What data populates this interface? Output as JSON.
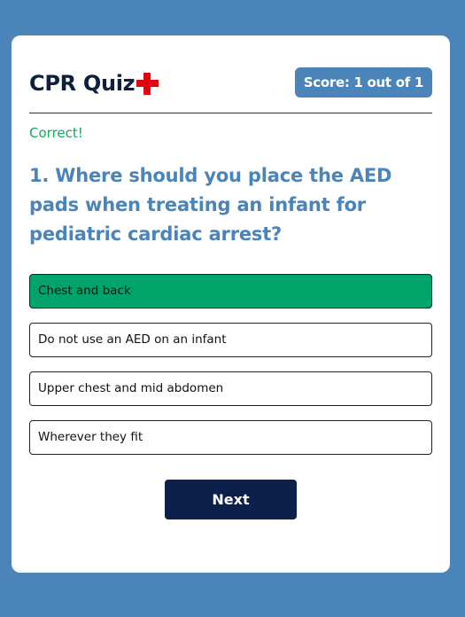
{
  "app": {
    "title": "CPR Quiz",
    "logo_icon": "red-cross-icon",
    "colors": {
      "background": "#4a84b8",
      "accent": "#4a84b8",
      "correct": "#00a46b",
      "button": "#0d1f4b",
      "cross": "#e3000f"
    }
  },
  "score": {
    "label": "Score: 1 out of 1"
  },
  "feedback": {
    "text": "Correct!"
  },
  "question": {
    "text": "1. Where should you place the AED pads when treating an infant for pediatric cardiac arrest?"
  },
  "answers": [
    {
      "label": "Chest and back",
      "state": "correct"
    },
    {
      "label": "Do not use an AED on an infant",
      "state": "default"
    },
    {
      "label": "Upper chest and mid abdomen",
      "state": "default"
    },
    {
      "label": "Wherever they fit",
      "state": "default"
    }
  ],
  "actions": {
    "next_label": "Next"
  }
}
